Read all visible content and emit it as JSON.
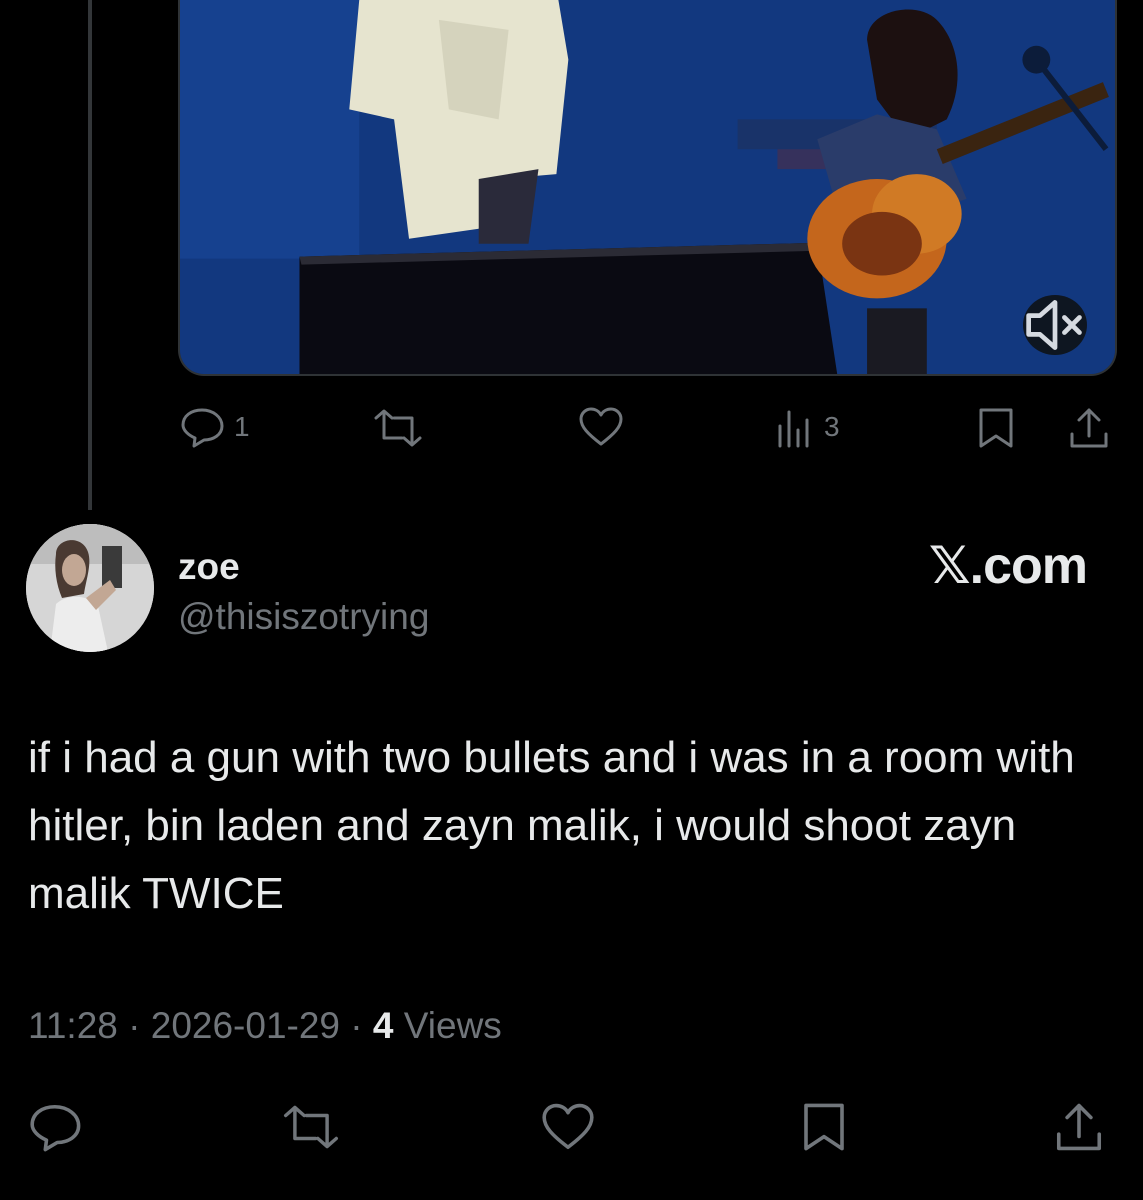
{
  "quoted_post": {
    "media": {
      "mute_icon": "speaker-muted-icon",
      "colors": {
        "stage": "#143d8c",
        "guitar": "#c4661c",
        "jacket": "#eae9d2"
      }
    },
    "actions": {
      "reply_count": "1",
      "repost_count": "",
      "like_count": "",
      "views_count": "3"
    }
  },
  "post": {
    "author_name": "zoe",
    "author_handle": "@thisiszotrying",
    "brand": "𝕏.com",
    "text": "if i had a gun with two bullets and i was in a room with hitler, bin laden and zayn malik, i would shoot zayn malik TWICE",
    "time": "11:28",
    "date": "2026-01-29",
    "views_count": "4",
    "views_label": "Views",
    "separator": "·"
  },
  "icons": [
    "reply-icon",
    "repost-icon",
    "like-icon",
    "views-icon",
    "bookmark-icon",
    "share-icon"
  ],
  "colors": {
    "background": "#000000",
    "text": "#e7e9ea",
    "muted": "#71767b",
    "border": "#2f3336"
  }
}
